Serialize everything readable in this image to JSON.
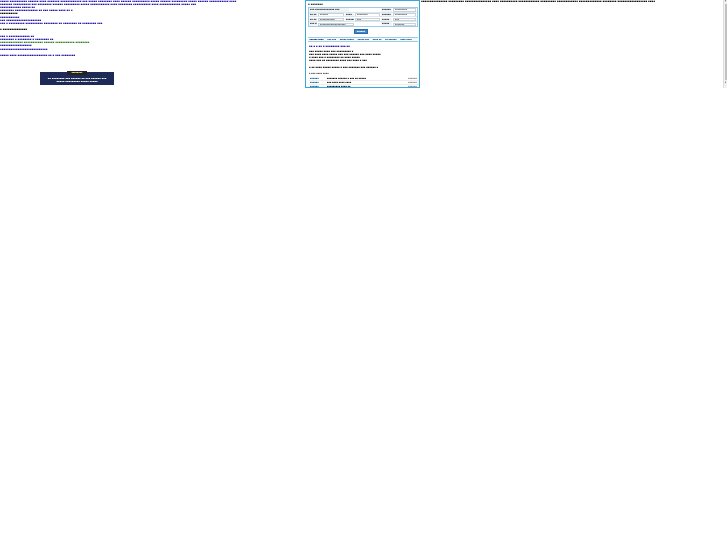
{
  "left": {
    "topline": "▪▪▪▪▪ ▪▪▪▪▪▪▪▪▪▪ ▪▪▪▪▪▪ ▪▪▪▪ ▪▪▪▪▪▪▪ ▪▪▪▪▪▪▪▪▪▪▪▪ ▪▪▪ ▪▪▪▪▪ ▪▪▪▪▪▪▪▪ ▪▪▪▪ ▪▪▪▪▪▪ ▪▪▪▪▪▪▪▪▪▪ ▪▪▪▪▪ ▪▪▪▪▪▪ ▪▪▪▪▪▪▪▪▪ ▪▪▪▪▪ ▪▪▪▪▪▪ ▪▪▪▪▪▪▪▪▪▪▪ ▪▪▪▪",
    "topline2": "▪▪▪▪▪▪▪ ▪▪▪▪▪▪▪▪▪▪ ▪▪▪ ▪▪▪▪▪▪▪▪ ▪▪▪▪▪▪ ▪▪▪▪▪▪▪▪▪ ▪▪▪▪▪ ▪▪▪▪▪▪▪▪▪▪▪ ▪▪▪▪ ▪▪▪▪▪▪▪▪ ▪▪▪▪▪▪▪▪▪▪ ▪▪▪▪ ▪▪▪▪▪▪▪▪▪▪▪▪ ▪▪▪▪▪ ▪▪▪",
    "lines": [
      {
        "text": "▪▪▪▪▪▪▪▪▪▪▪▪ ▪▪▪▪▪ ▪▪",
        "cls": "lnk"
      },
      {
        "text": "▪▪▪▪▪▪▪▪ ▪▪▪▪▪▪▪▪▪▪▪▪▪ ▪▪ ▪▪▪ ▪▪▪▪▪ ▪▪▪▪ ▪▪ ▪",
        "cls": "lnk"
      },
      {
        "text": "▪▪▪▪▪▪▪▪▪▪",
        "cls": "blk"
      },
      {
        "text": "▪▪▪▪▪▪▪▪▪▪▪",
        "cls": "lnk"
      },
      {
        "text": "▪▪▪ ▪▪▪▪▪▪▪▪▪▪▪▪▪▪▪▪▪▪▪▪",
        "cls": "lnk"
      },
      {
        "text": "▪▪▪ ▪ ▪▪▪▪▪▪▪▪▪ ▪▪▪▪▪▪▪▪▪▪ ▪▪▪▪▪▪▪▪ ▪▪ ▪▪▪▪▪▪▪▪ ▪▪ ▪▪▪▪▪▪▪▪ ▪▪▪",
        "cls": "lnk"
      },
      {
        "text": "",
        "cls": "blk"
      },
      {
        "text": "▪ ▪▪▪▪▪▪▪▪▪▪▪▪▪▪",
        "cls": "blk"
      },
      {
        "text": "",
        "cls": "blk"
      },
      {
        "text": "▪▪▪ ▪ ▪▪▪▪▪▪▪▪▪▪▪▪ ▪▪",
        "cls": "lnk"
      },
      {
        "text": "▪▪▪▪▪▪▪▪ ▪ ▪▪▪▪▪▪▪▪ ▪ ▪▪▪▪▪▪▪▪ ▪▪",
        "cls": "lnk"
      },
      {
        "text": "▪▪▪▪▪▪▪▪▪▪▪▪▪ ▪▪▪▪▪▪▪▪▪▪▪ ▪▪▪▪▪▪ ▪▪▪▪▪▪▪▪▪▪▪ ▪▪▪▪▪▪▪▪",
        "cls": "ok"
      },
      {
        "text": "▪▪▪▪▪▪▪▪▪▪▪▪▪▪▪▪▪▪",
        "cls": "lnk"
      },
      {
        "text": "▪▪▪▪▪▪▪▪▪▪▪▪▪▪▪▪▪▪▪▪▪▪▪▪▪▪▪",
        "cls": "lnk"
      },
      {
        "text": "",
        "cls": "blk"
      },
      {
        "text": "▪▪▪▪▪ ▪▪▪▪ ▪▪▪▪▪▪▪▪▪▪▪▪▪▪▪▪▪ ▪▪ ▪ ▪▪▪ ▪▪▪▪▪▪▪▪",
        "cls": "lnk"
      }
    ],
    "banner_tag": "▪▪▪▪▪▪▪▪",
    "banner_line1": "▪▪ ▪▪▪▪▪▪▪▪ ▪▪▪ ▪▪▪▪▪▪ ▪▪ ▪▪▪ ▪▪▪▪▪▪ ▪▪▪",
    "banner_line2": "▪▪▪▪▪ ▪▪▪▪▪▪▪▪▪ ▪▪▪▪▪ ▪▪▪▪▪"
  },
  "panel": {
    "title": "▪ ▪▪▪▪▪▪▪",
    "rows": [
      {
        "l1": "▪▪▪ ▪▪▪▪▪▪▪▪▪▪▪▪▪ ▪▪▪",
        "v1": "",
        "l2": "",
        "v2": "",
        "l3": "▪▪▪▪▪▪",
        "v3": "▪▪▪▪▪▪▪▪▪"
      },
      {
        "l1": "▪▪ ▪▪",
        "v1": "▪▪▪▪▪▪",
        "l2": "▪▪▪▪",
        "v2": "▪▪▪▪▪▪▪▪",
        "l3": "▪▪▪▪▪▪",
        "v3": "▪▪▪▪▪▪▪▪▪"
      },
      {
        "l1": "▪▪ ▪▪",
        "v1": "▪▪▪▪▪▪▪▪▪▪▪",
        "l2": "▪▪▪▪▪▪▪",
        "v2": "▪▪▪",
        "l3": "▪▪▪▪▪",
        "v3": "▪▪▪"
      },
      {
        "l1": "▪▪▪ ▪▪▪",
        "v1": "▪▪▪▪▪▪▪▪▪▪▪▪▪▪▪▪▪▪▪",
        "l2": "",
        "v2": "",
        "l3": "▪▪▪▪▪",
        "v3": "▪▪▪▪▪▪▪"
      }
    ],
    "search_label": "▪▪▪▪▪▪",
    "tabs": [
      "▪▪▪▪▪▪ ▪▪▪▪",
      "▪▪▪ ▪▪▪",
      "▪▪▪▪▪ ▪▪▪▪▪",
      "▪▪▪▪▪ ▪▪▪",
      "▪▪▪▪ ▪▪",
      "▪▪ ▪▪▪▪▪▪",
      "▪▪▪▪ ▪▪▪▪"
    ],
    "headline": "▪▪ ▪ ▪ ▪▪ ▪ ▪▪▪▪▪▪▪▪ ▪▪▪ ▪▪",
    "paragraphs": [
      "▪▪▪ ▪▪▪▪▪ ▪▪▪▪ ▪▪▪ ▪▪▪▪▪▪▪▪▪ ▪",
      "▪▪▪ ▪▪▪▪ ▪▪▪▪ ▪▪▪▪▪ ▪▪▪ ▪▪▪ ▪▪▪▪▪▪ ▪▪▪ ▪▪▪▪ ▪▪▪▪▪",
      "▪ ▪▪▪▪ ▪▪▪ ▪ ▪▪▪▪▪▪▪▪ ▪▪ ▪▪▪▪ ▪▪▪▪▪",
      "▪▪▪▪ ▪▪▪ ▪▪ ▪▪▪▪▪▪▪▪ ▪▪▪▪ ▪▪▪ ▪▪▪▪ ▪ ▪▪▪",
      "",
      "▪ ▪▪ ▪▪▪▪ ▪▪▪▪▪ ▪▪▪▪▪ ▪ ▪▪▪ ▪▪▪▪▪▪▪ ▪▪▪ ▪▪▪▪▪▪ ▪"
    ],
    "section_label": "▪ ▪▪▪ ▪▪▪▪ ▪▪▪▪",
    "news": [
      {
        "cat": "▪▪▪▪▪▪",
        "title": "▪▪▪▪▪▪▪ ▪▪▪▪▪▪ ▪ ▪▪▪ ▪▪ ▪▪▪▪▪",
        "date": "▪▪▪▪▪▪"
      },
      {
        "cat": "▪▪▪▪▪▪",
        "title": "▪▪▪ ▪▪▪▪ ▪▪▪▪ ▪▪▪▪",
        "date": "▪▪▪▪▪▪"
      },
      {
        "cat": "▪▪▪▪▪▪",
        "title": "▪▪▪▪▪▪▪▪▪ ▪▪▪▪ ▪▪",
        "date": "▪▪▪▪▪▪"
      }
    ]
  },
  "right": {
    "topline": "▪▪▪▪▪▪▪▪▪▪▪▪▪▪▪ ▪▪▪▪▪▪▪▪▪ ▪▪▪▪▪▪▪▪▪▪▪▪▪▪▪ ▪▪▪▪ ▪▪▪▪▪▪▪▪▪▪ ▪▪▪▪▪▪▪▪▪▪▪▪ ▪▪▪▪▪▪▪▪▪ ▪▪▪▪▪▪▪▪▪▪▪▪ ▪▪▪▪▪▪▪▪▪▪▪▪▪ ▪▪▪▪▪▪▪▪ ▪▪▪▪▪▪▪▪▪▪▪▪▪▪▪▪▪ ▪▪▪▪"
  },
  "scrollbar": {
    "up": "▲",
    "down": "▼"
  },
  "colors": {
    "panel_border": "#3aa7d9",
    "banner_bg": "#1d2a56",
    "link": "#1a0dab",
    "button": "#3d88c8"
  }
}
